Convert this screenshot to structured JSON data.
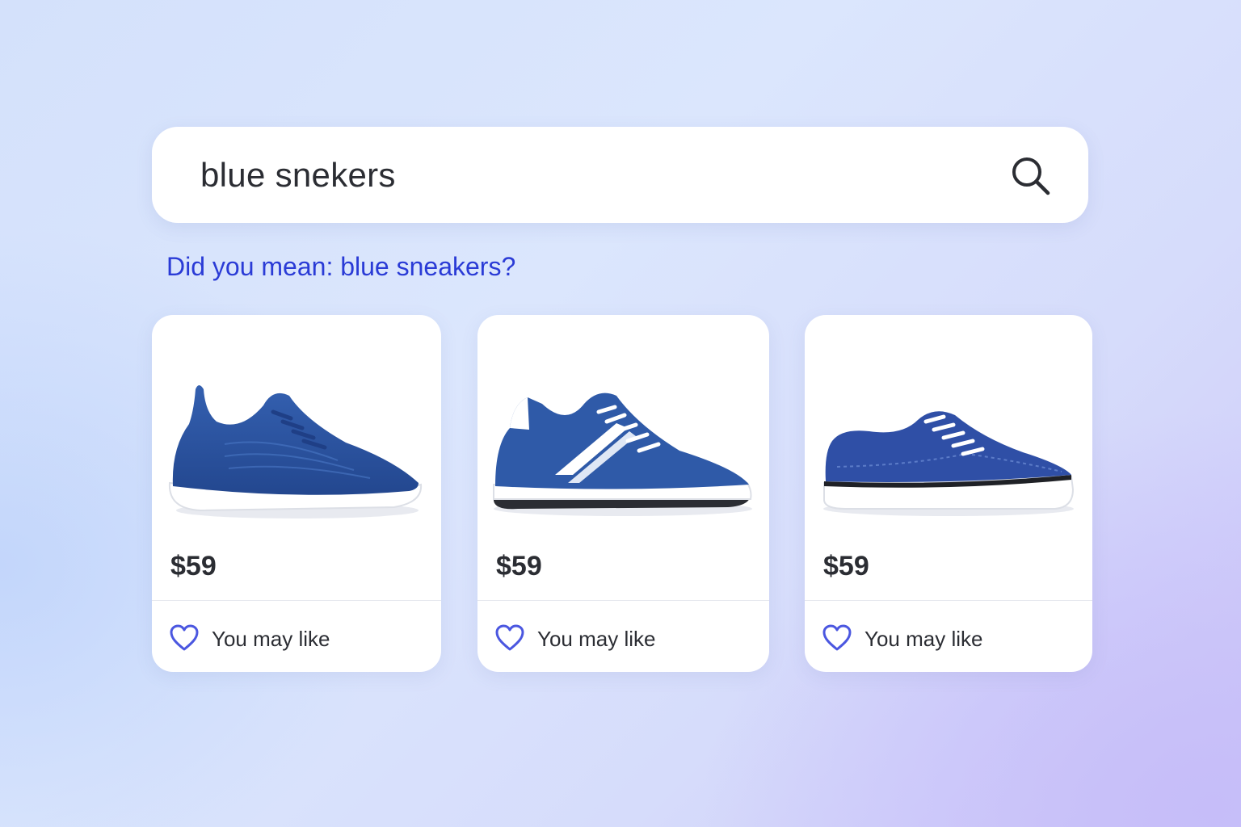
{
  "search": {
    "query": "blue snekers",
    "icon": "search-icon"
  },
  "suggestion": {
    "text": "Did you mean: blue sneakers?"
  },
  "products": [
    {
      "price": "$59",
      "like_label": "You may like",
      "image": "blue knit running sneaker"
    },
    {
      "price": "$59",
      "like_label": "You may like",
      "image": "blue retro trainer with white stripe"
    },
    {
      "price": "$59",
      "like_label": "You may like",
      "image": "blue canvas low-top sneaker"
    }
  ],
  "colors": {
    "accent": "#2a3bd6",
    "heart": "#4b57e0",
    "shoe_blue": "#2f5aa8",
    "text": "#2b2d33"
  }
}
